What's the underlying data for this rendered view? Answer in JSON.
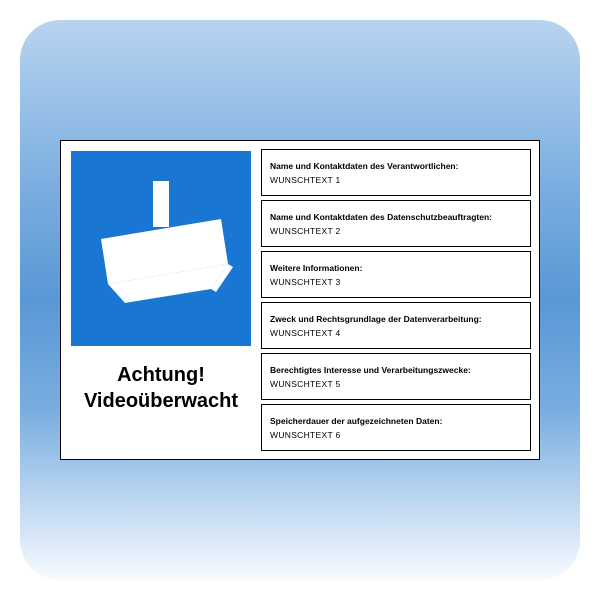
{
  "sign": {
    "warning_line1": "Achtung!",
    "warning_line2": "Videoüberwacht",
    "icon": "cctv-camera",
    "fields": [
      {
        "label": "Name und Kontaktdaten des Verantwortlichen:",
        "value": "WUNSCHTEXT 1"
      },
      {
        "label": "Name und Kontaktdaten des Datenschutzbeauftragten:",
        "value": "WUNSCHTEXT 2"
      },
      {
        "label": "Weitere Informationen:",
        "value": "WUNSCHTEXT 3"
      },
      {
        "label": "Zweck und Rechtsgrundlage der Datenverarbeitung:",
        "value": "WUNSCHTEXT 4"
      },
      {
        "label": "Berechtigtes Interesse und Verarbeitungszwecke:",
        "value": "WUNSCHTEXT 5"
      },
      {
        "label": "Speicherdauer der aufgezeichneten Daten:",
        "value": "WUNSCHTEXT 6"
      }
    ],
    "colors": {
      "accent": "#1976d2",
      "text": "#000000"
    }
  }
}
